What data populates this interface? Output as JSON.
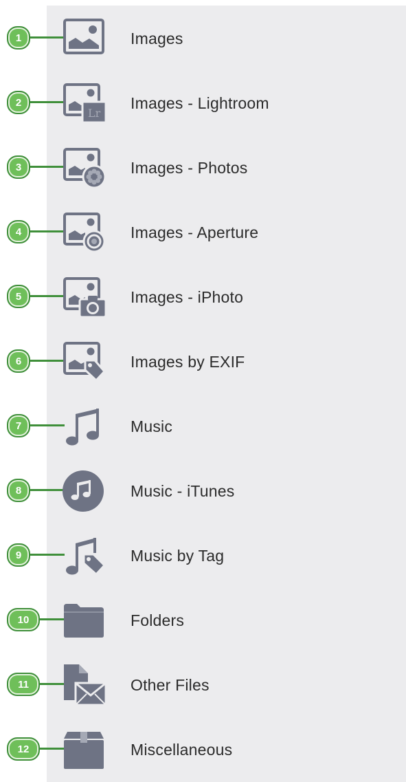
{
  "items": [
    {
      "num": "1",
      "label": "Images",
      "icon": "image-icon"
    },
    {
      "num": "2",
      "label": "Images - Lightroom",
      "icon": "lightroom-image-icon"
    },
    {
      "num": "3",
      "label": "Images - Photos",
      "icon": "photos-image-icon"
    },
    {
      "num": "4",
      "label": "Images - Aperture",
      "icon": "aperture-image-icon"
    },
    {
      "num": "5",
      "label": "Images - iPhoto",
      "icon": "iphoto-image-icon"
    },
    {
      "num": "6",
      "label": "Images by EXIF",
      "icon": "image-tag-icon"
    },
    {
      "num": "7",
      "label": "Music",
      "icon": "music-note-icon"
    },
    {
      "num": "8",
      "label": "Music - iTunes",
      "icon": "itunes-icon"
    },
    {
      "num": "9",
      "label": "Music by Tag",
      "icon": "music-tag-icon"
    },
    {
      "num": "10",
      "label": "Folders",
      "icon": "folder-icon"
    },
    {
      "num": "11",
      "label": "Other Files",
      "icon": "other-files-icon"
    },
    {
      "num": "12",
      "label": "Miscellaneous",
      "icon": "box-icon"
    }
  ],
  "colors": {
    "panel": "#ececee",
    "icon": "#6e7384",
    "badge_fill": "#6fbf5a",
    "badge_stroke": "#3f8f3a",
    "label": "#2b2b2b"
  }
}
